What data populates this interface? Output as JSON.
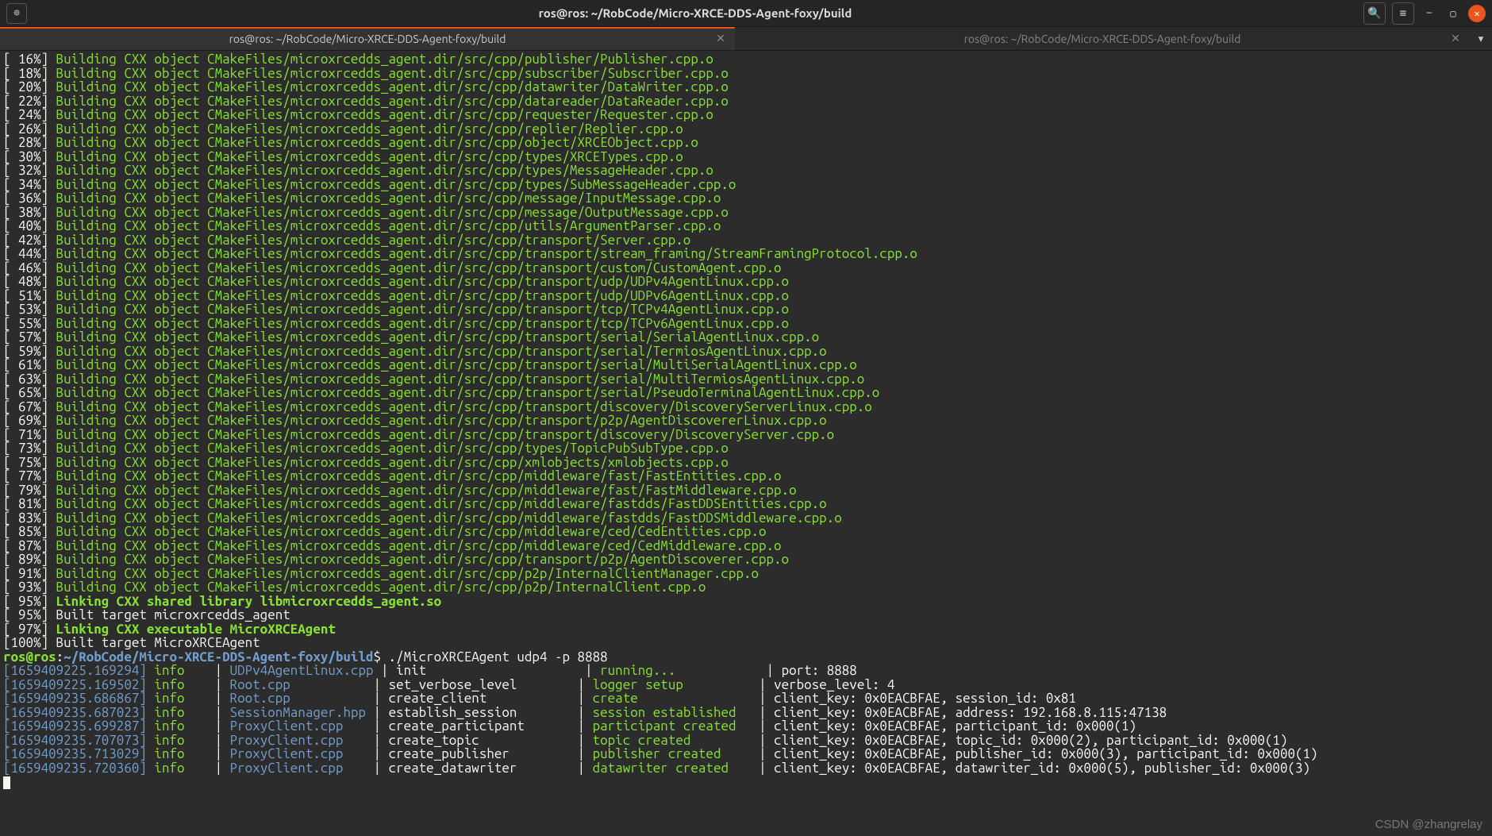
{
  "titlebar": {
    "title": "ros@ros: ~/RobCode/Micro-XRCE-DDS-Agent-foxy/build"
  },
  "tabs": {
    "active": "ros@ros: ~/RobCode/Micro-XRCE-DDS-Agent-foxy/build",
    "inactive": "ros@ros: ~/RobCode/Micro-XRCE-DDS-Agent-foxy/build"
  },
  "build_lines": [
    {
      "pct": "[ 16%]",
      "txt": " Building CXX object CMakeFiles/microxrcedds_agent.dir/src/cpp/publisher/Publisher.cpp.o"
    },
    {
      "pct": "[ 18%]",
      "txt": " Building CXX object CMakeFiles/microxrcedds_agent.dir/src/cpp/subscriber/Subscriber.cpp.o"
    },
    {
      "pct": "[ 20%]",
      "txt": " Building CXX object CMakeFiles/microxrcedds_agent.dir/src/cpp/datawriter/DataWriter.cpp.o"
    },
    {
      "pct": "[ 22%]",
      "txt": " Building CXX object CMakeFiles/microxrcedds_agent.dir/src/cpp/datareader/DataReader.cpp.o"
    },
    {
      "pct": "[ 24%]",
      "txt": " Building CXX object CMakeFiles/microxrcedds_agent.dir/src/cpp/requester/Requester.cpp.o"
    },
    {
      "pct": "[ 26%]",
      "txt": " Building CXX object CMakeFiles/microxrcedds_agent.dir/src/cpp/replier/Replier.cpp.o"
    },
    {
      "pct": "[ 28%]",
      "txt": " Building CXX object CMakeFiles/microxrcedds_agent.dir/src/cpp/object/XRCEObject.cpp.o"
    },
    {
      "pct": "[ 30%]",
      "txt": " Building CXX object CMakeFiles/microxrcedds_agent.dir/src/cpp/types/XRCETypes.cpp.o"
    },
    {
      "pct": "[ 32%]",
      "txt": " Building CXX object CMakeFiles/microxrcedds_agent.dir/src/cpp/types/MessageHeader.cpp.o"
    },
    {
      "pct": "[ 34%]",
      "txt": " Building CXX object CMakeFiles/microxrcedds_agent.dir/src/cpp/types/SubMessageHeader.cpp.o"
    },
    {
      "pct": "[ 36%]",
      "txt": " Building CXX object CMakeFiles/microxrcedds_agent.dir/src/cpp/message/InputMessage.cpp.o"
    },
    {
      "pct": "[ 38%]",
      "txt": " Building CXX object CMakeFiles/microxrcedds_agent.dir/src/cpp/message/OutputMessage.cpp.o"
    },
    {
      "pct": "[ 40%]",
      "txt": " Building CXX object CMakeFiles/microxrcedds_agent.dir/src/cpp/utils/ArgumentParser.cpp.o"
    },
    {
      "pct": "[ 42%]",
      "txt": " Building CXX object CMakeFiles/microxrcedds_agent.dir/src/cpp/transport/Server.cpp.o"
    },
    {
      "pct": "[ 44%]",
      "txt": " Building CXX object CMakeFiles/microxrcedds_agent.dir/src/cpp/transport/stream_framing/StreamFramingProtocol.cpp.o"
    },
    {
      "pct": "[ 46%]",
      "txt": " Building CXX object CMakeFiles/microxrcedds_agent.dir/src/cpp/transport/custom/CustomAgent.cpp.o"
    },
    {
      "pct": "[ 48%]",
      "txt": " Building CXX object CMakeFiles/microxrcedds_agent.dir/src/cpp/transport/udp/UDPv4AgentLinux.cpp.o"
    },
    {
      "pct": "[ 51%]",
      "txt": " Building CXX object CMakeFiles/microxrcedds_agent.dir/src/cpp/transport/udp/UDPv6AgentLinux.cpp.o"
    },
    {
      "pct": "[ 53%]",
      "txt": " Building CXX object CMakeFiles/microxrcedds_agent.dir/src/cpp/transport/tcp/TCPv4AgentLinux.cpp.o"
    },
    {
      "pct": "[ 55%]",
      "txt": " Building CXX object CMakeFiles/microxrcedds_agent.dir/src/cpp/transport/tcp/TCPv6AgentLinux.cpp.o"
    },
    {
      "pct": "[ 57%]",
      "txt": " Building CXX object CMakeFiles/microxrcedds_agent.dir/src/cpp/transport/serial/SerialAgentLinux.cpp.o"
    },
    {
      "pct": "[ 59%]",
      "txt": " Building CXX object CMakeFiles/microxrcedds_agent.dir/src/cpp/transport/serial/TermiosAgentLinux.cpp.o"
    },
    {
      "pct": "[ 61%]",
      "txt": " Building CXX object CMakeFiles/microxrcedds_agent.dir/src/cpp/transport/serial/MultiSerialAgentLinux.cpp.o"
    },
    {
      "pct": "[ 63%]",
      "txt": " Building CXX object CMakeFiles/microxrcedds_agent.dir/src/cpp/transport/serial/MultiTermiosAgentLinux.cpp.o"
    },
    {
      "pct": "[ 65%]",
      "txt": " Building CXX object CMakeFiles/microxrcedds_agent.dir/src/cpp/transport/serial/PseudoTerminalAgentLinux.cpp.o"
    },
    {
      "pct": "[ 67%]",
      "txt": " Building CXX object CMakeFiles/microxrcedds_agent.dir/src/cpp/transport/discovery/DiscoveryServerLinux.cpp.o"
    },
    {
      "pct": "[ 69%]",
      "txt": " Building CXX object CMakeFiles/microxrcedds_agent.dir/src/cpp/transport/p2p/AgentDiscovererLinux.cpp.o"
    },
    {
      "pct": "[ 71%]",
      "txt": " Building CXX object CMakeFiles/microxrcedds_agent.dir/src/cpp/transport/discovery/DiscoveryServer.cpp.o"
    },
    {
      "pct": "[ 73%]",
      "txt": " Building CXX object CMakeFiles/microxrcedds_agent.dir/src/cpp/types/TopicPubSubType.cpp.o"
    },
    {
      "pct": "[ 75%]",
      "txt": " Building CXX object CMakeFiles/microxrcedds_agent.dir/src/cpp/xmlobjects/xmlobjects.cpp.o"
    },
    {
      "pct": "[ 77%]",
      "txt": " Building CXX object CMakeFiles/microxrcedds_agent.dir/src/cpp/middleware/fast/FastEntities.cpp.o"
    },
    {
      "pct": "[ 79%]",
      "txt": " Building CXX object CMakeFiles/microxrcedds_agent.dir/src/cpp/middleware/fast/FastMiddleware.cpp.o"
    },
    {
      "pct": "[ 81%]",
      "txt": " Building CXX object CMakeFiles/microxrcedds_agent.dir/src/cpp/middleware/fastdds/FastDDSEntities.cpp.o"
    },
    {
      "pct": "[ 83%]",
      "txt": " Building CXX object CMakeFiles/microxrcedds_agent.dir/src/cpp/middleware/fastdds/FastDDSMiddleware.cpp.o"
    },
    {
      "pct": "[ 85%]",
      "txt": " Building CXX object CMakeFiles/microxrcedds_agent.dir/src/cpp/middleware/ced/CedEntities.cpp.o"
    },
    {
      "pct": "[ 87%]",
      "txt": " Building CXX object CMakeFiles/microxrcedds_agent.dir/src/cpp/middleware/ced/CedMiddleware.cpp.o"
    },
    {
      "pct": "[ 89%]",
      "txt": " Building CXX object CMakeFiles/microxrcedds_agent.dir/src/cpp/transport/p2p/AgentDiscoverer.cpp.o"
    },
    {
      "pct": "[ 91%]",
      "txt": " Building CXX object CMakeFiles/microxrcedds_agent.dir/src/cpp/p2p/InternalClientManager.cpp.o"
    },
    {
      "pct": "[ 93%]",
      "txt": " Building CXX object CMakeFiles/microxrcedds_agent.dir/src/cpp/p2p/InternalClient.cpp.o"
    }
  ],
  "link_lines": [
    {
      "pct": "[ 95%]",
      "txt": " Linking CXX shared library libmicroxrcedds_agent.so",
      "cls": "bold-green"
    },
    {
      "pct": "[ 95%]",
      "txt": " Built target microxrcedds_agent",
      "cls": "white-txt"
    },
    {
      "pct": "[ 97%]",
      "txt": " Linking CXX executable MicroXRCEAgent",
      "cls": "bold-green"
    },
    {
      "pct": "[100%]",
      "txt": " Built target MicroXRCEAgent",
      "cls": "white-txt"
    }
  ],
  "prompt": {
    "user": "ros@ros",
    "colon": ":",
    "path": "~/RobCode/Micro-XRCE-DDS-Agent-foxy/build",
    "dollar": "$ ",
    "cmd": "./MicroXRCEAgent udp4 -p 8888"
  },
  "log_lines": [
    {
      "ts": "[1659409225.169294]",
      "lvl": "info",
      "file": "UDPv4AgentLinux.cpp",
      "fn": "init",
      "state": "running...",
      "rest": "port: 8888"
    },
    {
      "ts": "[1659409225.169502]",
      "lvl": "info",
      "file": "Root.cpp",
      "fn": "set_verbose_level",
      "state": "logger setup",
      "rest": "verbose_level: 4"
    },
    {
      "ts": "[1659409235.686867]",
      "lvl": "info",
      "file": "Root.cpp",
      "fn": "create_client",
      "state": "create",
      "rest": "client_key: 0x0EACBFAE, session_id: 0x81"
    },
    {
      "ts": "[1659409235.687023]",
      "lvl": "info",
      "file": "SessionManager.hpp",
      "fn": "establish_session",
      "state": "session established",
      "rest": "client_key: 0x0EACBFAE, address: 192.168.8.115:47138"
    },
    {
      "ts": "[1659409235.699287]",
      "lvl": "info",
      "file": "ProxyClient.cpp",
      "fn": "create_participant",
      "state": "participant created",
      "rest": "client_key: 0x0EACBFAE, participant_id: 0x000(1)"
    },
    {
      "ts": "[1659409235.707073]",
      "lvl": "info",
      "file": "ProxyClient.cpp",
      "fn": "create_topic",
      "state": "topic created",
      "rest": "client_key: 0x0EACBFAE, topic_id: 0x000(2), participant_id: 0x000(1)"
    },
    {
      "ts": "[1659409235.713029]",
      "lvl": "info",
      "file": "ProxyClient.cpp",
      "fn": "create_publisher",
      "state": "publisher created",
      "rest": "client_key: 0x0EACBFAE, publisher_id: 0x000(3), participant_id: 0x000(1)"
    },
    {
      "ts": "[1659409235.720360]",
      "lvl": "info",
      "file": "ProxyClient.cpp",
      "fn": "create_datawriter",
      "state": "datawriter created",
      "rest": "client_key: 0x0EACBFAE, datawriter_id: 0x000(5), publisher_id: 0x000(3)"
    }
  ],
  "watermark": "CSDN @zhangrelay"
}
